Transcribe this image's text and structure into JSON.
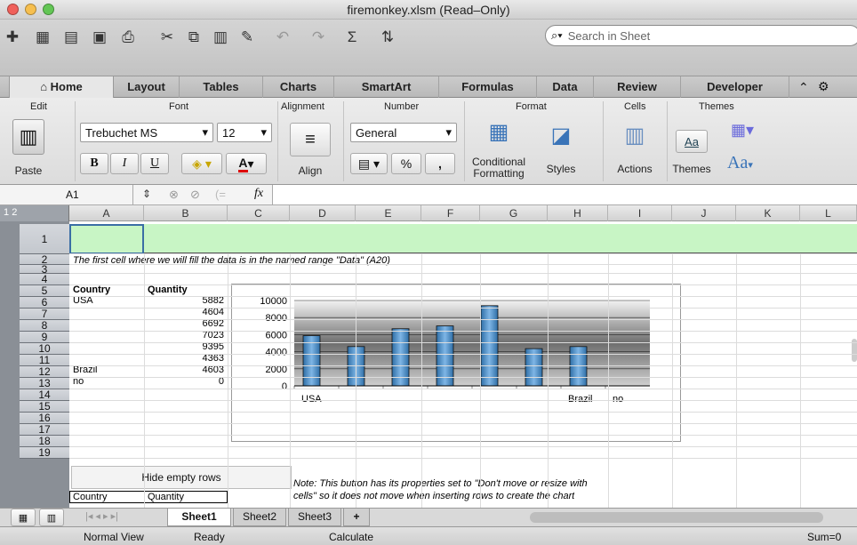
{
  "window": {
    "title": "firemonkey.xlsm  (Read–Only)"
  },
  "toolbar": {
    "search_placeholder": "Search in Sheet"
  },
  "ribbon_tabs": [
    "Home",
    "Layout",
    "Tables",
    "Charts",
    "SmartArt",
    "Formulas",
    "Data",
    "Review",
    "Developer"
  ],
  "ribbon": {
    "groups": {
      "edit": "Edit",
      "font": "Font",
      "alignment": "Alignment",
      "number": "Number",
      "format": "Format",
      "cells": "Cells",
      "themes": "Themes"
    },
    "paste_label": "Paste",
    "font_name": "Trebuchet MS",
    "font_size": "12",
    "bold": "B",
    "italic": "I",
    "underline": "U",
    "color_a": "A",
    "align_label": "Align",
    "number_format": "General",
    "percent": "%",
    "comma": ",",
    "conditional_formatting_1": "Conditional",
    "conditional_formatting_2": "Formatting",
    "styles_label": "Styles",
    "actions_label": "Actions",
    "themes_label": "Themes",
    "aa_label": "Aa",
    "theme_swatch": "Aa"
  },
  "formula_bar": {
    "name_box": "A1",
    "fx": "fx",
    "formula": ""
  },
  "outline_levels": [
    "1",
    "2"
  ],
  "columns": [
    "A",
    "B",
    "C",
    "D",
    "E",
    "F",
    "G",
    "H",
    "I",
    "J",
    "K",
    "L"
  ],
  "rows": [
    "1",
    "2",
    "3",
    "4",
    "5",
    "6",
    "7",
    "8",
    "9",
    "10",
    "11",
    "12",
    "13",
    "14",
    "15",
    "16",
    "17",
    "18",
    "19"
  ],
  "cells": {
    "a2": "The first cell where we will fill the data is in the named range \"Data\" (A20)",
    "a4": "Country",
    "b4": "Quantity",
    "a5": "USA",
    "b5": "5882",
    "b6": "4604",
    "b7": "6692",
    "b8": "7023",
    "b9": "9395",
    "b10": "4363",
    "a11": "Brazil",
    "b11": "4603",
    "a12": "no",
    "b12": "0",
    "a19": "Country",
    "b19": "Quantity",
    "note1": "Note: This button has its properties set to \"Don't move or resize with",
    "note2": "cells\" so it does not move when inserting rows to create the chart"
  },
  "hide_button": "Hide empty rows",
  "chart_data": {
    "type": "bar",
    "categories": [
      "USA",
      "",
      "",
      "",
      "",
      "",
      "Brazil",
      "no"
    ],
    "values": [
      5882,
      4604,
      6692,
      7023,
      9395,
      4363,
      4603,
      0
    ],
    "ylim": [
      0,
      10000
    ],
    "yticks": [
      "10000",
      "8000",
      "6000",
      "4000",
      "2000",
      "0"
    ],
    "bar_color": "#3f7fb3"
  },
  "sheets": [
    "Sheet1",
    "Sheet2",
    "Sheet3"
  ],
  "sheet_add": "+",
  "status": {
    "view": "Normal View",
    "ready": "Ready",
    "calculate": "Calculate",
    "sum": "Sum=0"
  }
}
